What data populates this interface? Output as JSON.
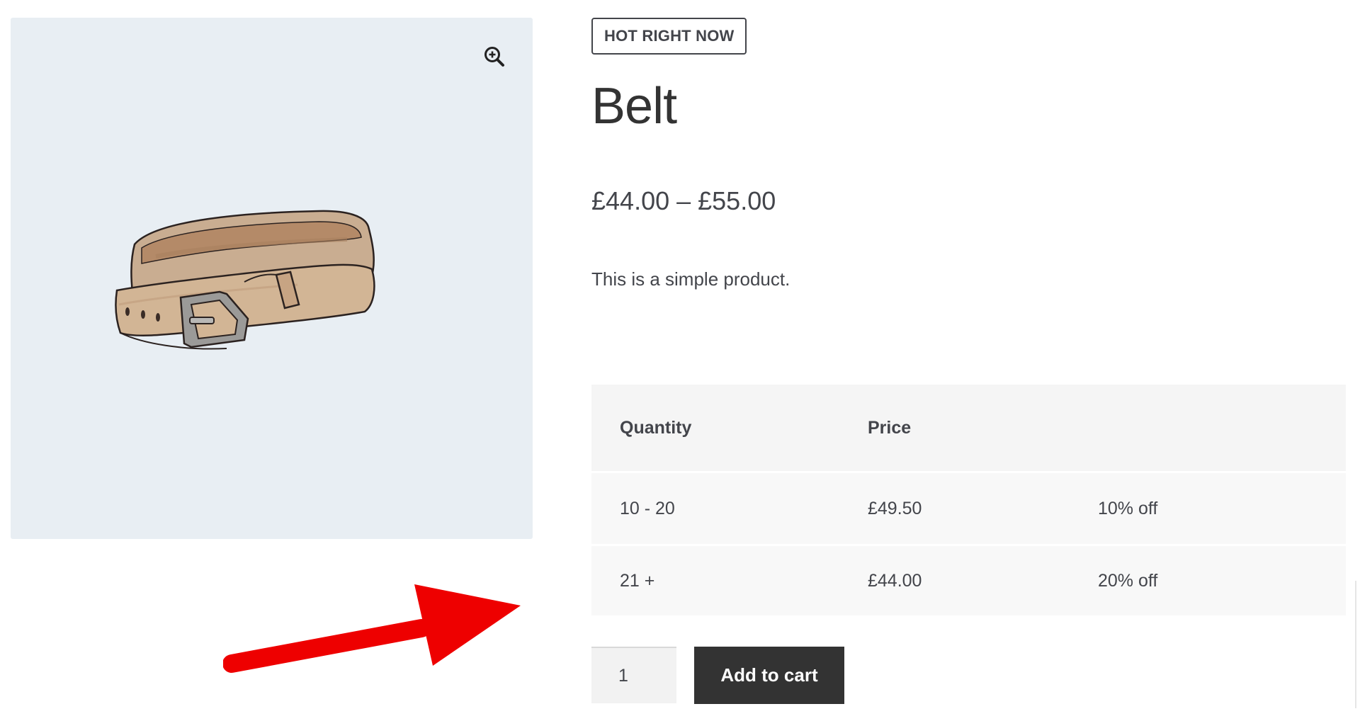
{
  "product": {
    "badge": "HOT RIGHT NOW",
    "title": "Belt",
    "price": "£44.00 – £55.00",
    "short_description": "This is a simple product.",
    "image_alt": "Belt"
  },
  "icons": {
    "zoom": "magnifier-plus-icon",
    "arrow": "red-annotation-arrow"
  },
  "tier_table": {
    "headers": [
      "Quantity",
      "Price",
      ""
    ],
    "rows": [
      {
        "quantity": "10 - 20",
        "price": "£49.50",
        "discount": "10% off"
      },
      {
        "quantity": "21 +",
        "price": "£44.00",
        "discount": "20% off"
      }
    ]
  },
  "cart": {
    "quantity": "1",
    "button_label": "Add to cart"
  },
  "colors": {
    "gallery_bg": "#e8eef3",
    "text": "#43454b",
    "button_bg": "#333333",
    "arrow": "#ee0000"
  }
}
